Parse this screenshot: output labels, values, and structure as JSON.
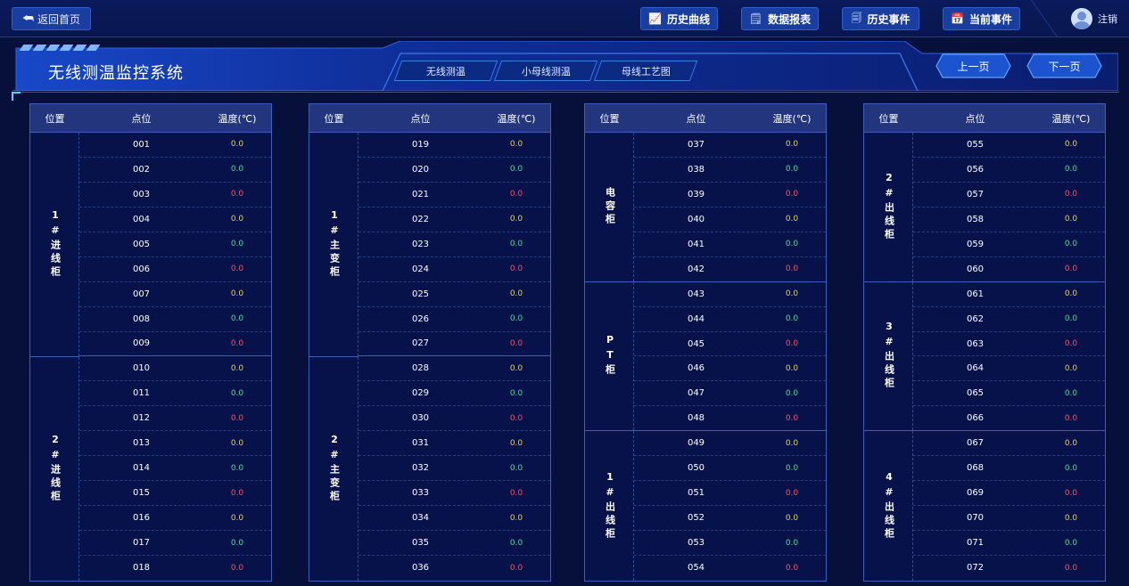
{
  "topbar": {
    "back_label": "返回首页",
    "nav": [
      {
        "label": "历史曲线",
        "icon": "chart-icon"
      },
      {
        "label": "数据报表",
        "icon": "report-icon"
      },
      {
        "label": "历史事件",
        "icon": "history-icon"
      },
      {
        "label": "当前事件",
        "icon": "calendar-icon"
      }
    ],
    "logout_label": "注销"
  },
  "header": {
    "title": "无线测温监控系统",
    "tabs": [
      "无线测温",
      "小母线测温",
      "母线工艺图"
    ],
    "prev_label": "上一页",
    "next_label": "下一页"
  },
  "table_headers": {
    "location": "位置",
    "point": "点位",
    "temp": "温度(℃)"
  },
  "colors": {
    "yellow": "#e6d34e",
    "green": "#3ee08c",
    "red": "#ff4d5b"
  },
  "groups": [
    {
      "sections": [
        {
          "location": "1#进线柜",
          "points": [
            {
              "id": "001",
              "temp": "0.0",
              "status": "y"
            },
            {
              "id": "002",
              "temp": "0.0",
              "status": "g"
            },
            {
              "id": "003",
              "temp": "0.0",
              "status": "r"
            },
            {
              "id": "004",
              "temp": "0.0",
              "status": "y"
            },
            {
              "id": "005",
              "temp": "0.0",
              "status": "g"
            },
            {
              "id": "006",
              "temp": "0.0",
              "status": "r"
            },
            {
              "id": "007",
              "temp": "0.0",
              "status": "y"
            },
            {
              "id": "008",
              "temp": "0.0",
              "status": "g"
            },
            {
              "id": "009",
              "temp": "0.0",
              "status": "r"
            }
          ]
        },
        {
          "location": "2#进线柜",
          "points": [
            {
              "id": "010",
              "temp": "0.0",
              "status": "y"
            },
            {
              "id": "011",
              "temp": "0.0",
              "status": "g"
            },
            {
              "id": "012",
              "temp": "0.0",
              "status": "r"
            },
            {
              "id": "013",
              "temp": "0.0",
              "status": "y"
            },
            {
              "id": "014",
              "temp": "0.0",
              "status": "g"
            },
            {
              "id": "015",
              "temp": "0.0",
              "status": "r"
            },
            {
              "id": "016",
              "temp": "0.0",
              "status": "y"
            },
            {
              "id": "017",
              "temp": "0.0",
              "status": "g"
            },
            {
              "id": "018",
              "temp": "0.0",
              "status": "r"
            }
          ]
        }
      ]
    },
    {
      "sections": [
        {
          "location": "1#主变柜",
          "points": [
            {
              "id": "019",
              "temp": "0.0",
              "status": "y"
            },
            {
              "id": "020",
              "temp": "0.0",
              "status": "g"
            },
            {
              "id": "021",
              "temp": "0.0",
              "status": "r"
            },
            {
              "id": "022",
              "temp": "0.0",
              "status": "y"
            },
            {
              "id": "023",
              "temp": "0.0",
              "status": "g"
            },
            {
              "id": "024",
              "temp": "0.0",
              "status": "r"
            },
            {
              "id": "025",
              "temp": "0.0",
              "status": "y"
            },
            {
              "id": "026",
              "temp": "0.0",
              "status": "g"
            },
            {
              "id": "027",
              "temp": "0.0",
              "status": "r"
            }
          ]
        },
        {
          "location": "2#主变柜",
          "points": [
            {
              "id": "028",
              "temp": "0.0",
              "status": "y"
            },
            {
              "id": "029",
              "temp": "0.0",
              "status": "g"
            },
            {
              "id": "030",
              "temp": "0.0",
              "status": "r"
            },
            {
              "id": "031",
              "temp": "0.0",
              "status": "y"
            },
            {
              "id": "032",
              "temp": "0.0",
              "status": "g"
            },
            {
              "id": "033",
              "temp": "0.0",
              "status": "r"
            },
            {
              "id": "034",
              "temp": "0.0",
              "status": "y"
            },
            {
              "id": "035",
              "temp": "0.0",
              "status": "g"
            },
            {
              "id": "036",
              "temp": "0.0",
              "status": "r"
            }
          ]
        }
      ]
    },
    {
      "sections": [
        {
          "location": "电容柜",
          "points": [
            {
              "id": "037",
              "temp": "0.0",
              "status": "y"
            },
            {
              "id": "038",
              "temp": "0.0",
              "status": "g"
            },
            {
              "id": "039",
              "temp": "0.0",
              "status": "r"
            },
            {
              "id": "040",
              "temp": "0.0",
              "status": "y"
            },
            {
              "id": "041",
              "temp": "0.0",
              "status": "g"
            },
            {
              "id": "042",
              "temp": "0.0",
              "status": "r"
            }
          ]
        },
        {
          "location": "PT柜",
          "points": [
            {
              "id": "043",
              "temp": "0.0",
              "status": "y"
            },
            {
              "id": "044",
              "temp": "0.0",
              "status": "g"
            },
            {
              "id": "045",
              "temp": "0.0",
              "status": "r"
            },
            {
              "id": "046",
              "temp": "0.0",
              "status": "y"
            },
            {
              "id": "047",
              "temp": "0.0",
              "status": "g"
            },
            {
              "id": "048",
              "temp": "0.0",
              "status": "r"
            }
          ]
        },
        {
          "location": "1#出线柜",
          "points": [
            {
              "id": "049",
              "temp": "0.0",
              "status": "y"
            },
            {
              "id": "050",
              "temp": "0.0",
              "status": "g"
            },
            {
              "id": "051",
              "temp": "0.0",
              "status": "r"
            },
            {
              "id": "052",
              "temp": "0.0",
              "status": "y"
            },
            {
              "id": "053",
              "temp": "0.0",
              "status": "g"
            },
            {
              "id": "054",
              "temp": "0.0",
              "status": "r"
            }
          ]
        }
      ]
    },
    {
      "sections": [
        {
          "location": "2#出线柜",
          "points": [
            {
              "id": "055",
              "temp": "0.0",
              "status": "y"
            },
            {
              "id": "056",
              "temp": "0.0",
              "status": "g"
            },
            {
              "id": "057",
              "temp": "0.0",
              "status": "r"
            },
            {
              "id": "058",
              "temp": "0.0",
              "status": "y"
            },
            {
              "id": "059",
              "temp": "0.0",
              "status": "g"
            },
            {
              "id": "060",
              "temp": "0.0",
              "status": "r"
            }
          ]
        },
        {
          "location": "3#出线柜",
          "points": [
            {
              "id": "061",
              "temp": "0.0",
              "status": "y"
            },
            {
              "id": "062",
              "temp": "0.0",
              "status": "g"
            },
            {
              "id": "063",
              "temp": "0.0",
              "status": "r"
            },
            {
              "id": "064",
              "temp": "0.0",
              "status": "y"
            },
            {
              "id": "065",
              "temp": "0.0",
              "status": "g"
            },
            {
              "id": "066",
              "temp": "0.0",
              "status": "r"
            }
          ]
        },
        {
          "location": "4#出线柜",
          "points": [
            {
              "id": "067",
              "temp": "0.0",
              "status": "y"
            },
            {
              "id": "068",
              "temp": "0.0",
              "status": "g"
            },
            {
              "id": "069",
              "temp": "0.0",
              "status": "r"
            },
            {
              "id": "070",
              "temp": "0.0",
              "status": "y"
            },
            {
              "id": "071",
              "temp": "0.0",
              "status": "g"
            },
            {
              "id": "072",
              "temp": "0.0",
              "status": "r"
            }
          ]
        }
      ]
    }
  ]
}
